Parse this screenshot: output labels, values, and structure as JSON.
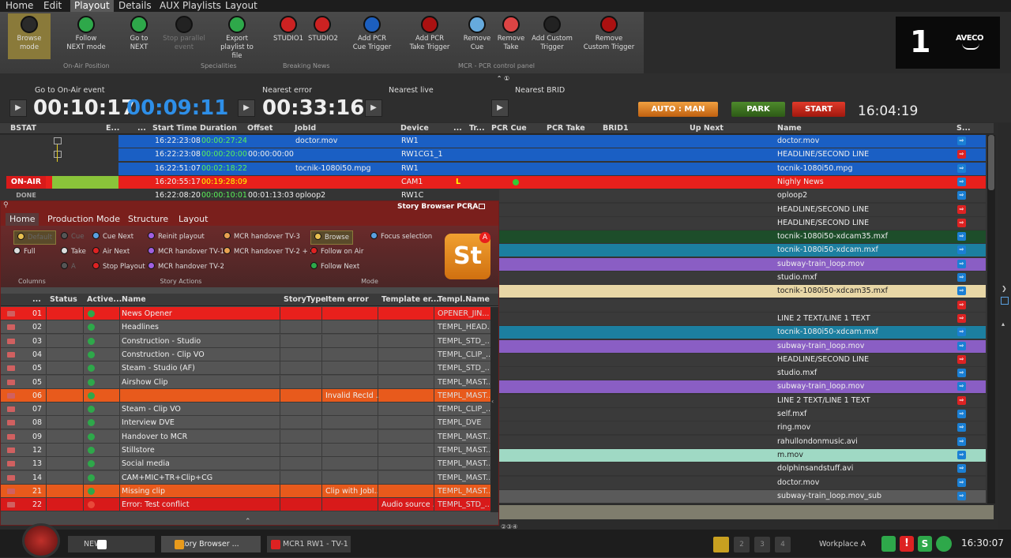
{
  "menu": [
    "Home",
    "Edit",
    "Playout",
    "Details",
    "AUX Playlists",
    "Layout"
  ],
  "menu_active": "Playout",
  "ribbon": {
    "buttons": [
      {
        "l1": "Browse",
        "l2": "mode",
        "icon": "browse-icon",
        "color": "#2a2a2a"
      },
      {
        "l1": "Follow",
        "l2": "NEXT mode",
        "icon": "follow-next-icon",
        "color": "#2ea84a"
      },
      {
        "l1": "Go to",
        "l2": "NEXT",
        "icon": "goto-next-icon",
        "color": "#2ea84a"
      },
      {
        "l1": "Stop parallel",
        "l2": "event",
        "icon": "stop-parallel-icon",
        "color": "#222"
      },
      {
        "l1": "Export",
        "l2": "playlist to file",
        "icon": "export-icon",
        "color": "#2ea84a"
      },
      {
        "l1": "STUDIO1",
        "l2": "",
        "icon": "news-icon",
        "color": "#c22"
      },
      {
        "l1": "STUDIO2",
        "l2": "",
        "icon": "news-icon",
        "color": "#c22"
      },
      {
        "l1": "Add PCR",
        "l2": "Cue Trigger",
        "icon": "add-pcr-cue-icon",
        "color": "#1c5fbf"
      },
      {
        "l1": "Add PCR",
        "l2": "Take Trigger",
        "icon": "add-pcr-take-icon",
        "color": "#a11"
      },
      {
        "l1": "Remove",
        "l2": "Cue",
        "icon": "remove-cue-icon",
        "color": "#6ad"
      },
      {
        "l1": "Remove",
        "l2": "Take",
        "icon": "remove-take-icon",
        "color": "#d44"
      },
      {
        "l1": "Add Custom",
        "l2": "Trigger",
        "icon": "add-custom-trigger-icon",
        "color": "#222"
      },
      {
        "l1": "Remove",
        "l2": "Custom Trigger",
        "icon": "remove-custom-trigger-icon",
        "color": "#a11"
      }
    ],
    "groups": [
      "On-Air Position",
      "Specialities",
      "Breaking News",
      "MCR - PCR control panel"
    ]
  },
  "brand": {
    "channel": "1",
    "logo": "AVECO"
  },
  "timers": {
    "goto_onair_label": "Go to On-Air event",
    "time1": "00:10:17",
    "time2": "00:09:11",
    "nearest_error_label": "Nearest error",
    "time3": "00:33:16",
    "nearest_live_label": "Nearest live",
    "nearest_brid_label": "Nearest BRID",
    "auto_man": "AUTO : MAN",
    "park": "PARK",
    "start": "START",
    "clock": "16:04:19"
  },
  "grid": {
    "columns": [
      "BSTAT",
      "E...",
      "...",
      "Start Time",
      "Duration",
      "Offset",
      "JobId",
      "Device",
      "...",
      "Tr...",
      "PCR Cue",
      "PCR Take",
      "BRID1",
      "Up Next",
      "Name",
      "S..."
    ],
    "rows": [
      {
        "status": "",
        "start": "16:22:23:08",
        "dur": "00:00:27:24",
        "offset": "",
        "job": "doctor.mov",
        "device": "RW1",
        "name": "doctor.mov",
        "bg": "#1a5fc4",
        "full": true,
        "ico": "#1a7fd4"
      },
      {
        "status": "",
        "start": "16:22:23:08",
        "dur": "00:00:20:00",
        "offset": "00:00:00:00",
        "job": "",
        "device": "RW1CG1_1",
        "name": "HEADLINE/SECOND LINE",
        "bg": "#1a5fc4",
        "full": true,
        "ico": "#d22"
      },
      {
        "status": "",
        "start": "16:22:51:07",
        "dur": "00:02:18:22",
        "offset": "",
        "job": "tocnik-1080i50.mpg",
        "device": "RW1",
        "name": "tocnik-1080i50.mpg",
        "bg": "#1a5fc4",
        "full": true,
        "ico": "#1a7fd4"
      },
      {
        "status": "ON-AIR",
        "start": "16:20:55:17",
        "dur": "00:19:28:09",
        "offset": "",
        "job": "",
        "device": "CAM1",
        "tr": "L",
        "name": "Nighly News",
        "bg": "#e8201c",
        "full": true,
        "ico": "#1a7fd4"
      },
      {
        "status": "DONE",
        "start": "16:22:08:20",
        "dur": "00:00:10:01",
        "offset": "00:01:13:03",
        "job": "oploop2",
        "device": "RW1C",
        "name": "oploop2",
        "bg": "#3a3a3a",
        "full": false,
        "ico": "#1a7fd4"
      },
      {
        "name": "HEADLINE/SECOND LINE",
        "bg": "#3a3a3a",
        "ico": "#d22"
      },
      {
        "name": "HEADLINE/SECOND LINE",
        "bg": "#3a3a3a",
        "ico": "#d22"
      },
      {
        "name": "tocnik-1080i50-xdcam35.mxf",
        "bg": "#1d4d2a",
        "ico": "#1a7fd4"
      },
      {
        "name": "tocnik-1080i50-xdcam.mxf",
        "bg": "#1c7fa0",
        "ico": "#1a7fd4"
      },
      {
        "name": "subway-train_loop.mov",
        "bg": "#8a5ec4",
        "ico": "#1a7fd4"
      },
      {
        "name": "studio.mxf",
        "bg": "#3a3a3a",
        "ico": "#1a7fd4"
      },
      {
        "name": "tocnik-1080i50-xdcam35.mxf",
        "bg": "#e8d7a6",
        "ico": "#1a7fd4",
        "dark": true
      },
      {
        "name": "",
        "bg": "#3a3a3a",
        "ico": "#d22"
      },
      {
        "name": "LINE 2 TEXT/LINE 1 TEXT",
        "bg": "#3a3a3a",
        "ico": "#d22"
      },
      {
        "name": "tocnik-1080i50-xdcam.mxf",
        "bg": "#1c7fa0",
        "ico": "#1a7fd4"
      },
      {
        "name": "subway-train_loop.mov",
        "bg": "#8a5ec4",
        "ico": "#1a7fd4"
      },
      {
        "name": "HEADLINE/SECOND LINE",
        "bg": "#3a3a3a",
        "ico": "#d22"
      },
      {
        "name": "studio.mxf",
        "bg": "#3a3a3a",
        "ico": "#1a7fd4"
      },
      {
        "name": "subway-train_loop.mov",
        "bg": "#8a5ec4",
        "ico": "#1a7fd4"
      },
      {
        "name": "LINE 2 TEXT/LINE 1 TEXT",
        "bg": "#3a3a3a",
        "ico": "#d22"
      },
      {
        "name": "self.mxf",
        "bg": "#3a3a3a",
        "ico": "#1a7fd4"
      },
      {
        "name": "ring.mov",
        "bg": "#3a3a3a",
        "ico": "#1a7fd4"
      },
      {
        "name": "rahullondonmusic.avi",
        "bg": "#3a3a3a",
        "ico": "#1a7fd4"
      },
      {
        "name": "m.mov",
        "bg": "#9fd9c4",
        "ico": "#1a7fd4",
        "dark": true
      },
      {
        "name": "dolphinsandstuff.avi",
        "bg": "#3a3a3a",
        "ico": "#1a7fd4"
      },
      {
        "name": "doctor.mov",
        "bg": "#3a3a3a",
        "ico": "#1a7fd4"
      },
      {
        "name": "subway-train_loop.mov_sub",
        "bg": "#5a5a5a",
        "ico": "#1a7fd4"
      }
    ]
  },
  "story_browser": {
    "title": "Story Browser PCRA",
    "tabs": [
      "Home",
      "Production Mode",
      "Structure",
      "Layout"
    ],
    "columns_group": {
      "label": "Columns",
      "items": [
        "Default",
        "Full"
      ]
    },
    "story_actions": {
      "label": "Story Actions",
      "items": [
        "Cue",
        "Cue Next",
        "Reinit playout",
        "MCR handover TV-3",
        "Take",
        "Air Next",
        "MCR handover TV-1",
        "MCR handover TV-2 + 3",
        "A",
        "Stop Playout",
        "MCR handover TV-2"
      ]
    },
    "mode": {
      "label": "Mode",
      "items": [
        "Browse",
        "Focus selection",
        "Follow on Air",
        "Follow Next"
      ]
    },
    "logo": "St",
    "header": [
      "...",
      "Status",
      "Active...",
      "Name",
      "StoryType",
      "Item error",
      "Template er...",
      "Templ.Name"
    ],
    "rows": [
      {
        "num": "01",
        "status": "ON-AIR",
        "active": "#2ea84a",
        "name": "News Opener",
        "err": "",
        "terr": "",
        "tname": "OPENER_JIN...",
        "bg": "#e8201c",
        "badge": "#c41818"
      },
      {
        "num": "02",
        "status": "NEXT",
        "active": "#2ea84a",
        "name": "Headlines",
        "err": "",
        "terr": "",
        "tname": "TEMPL_HEAD...",
        "bg": "#555",
        "badge": "#4a7a1c"
      },
      {
        "num": "03",
        "status": "",
        "active": "#2ea84a",
        "name": "Construction - Studio",
        "err": "",
        "terr": "",
        "tname": "TEMPL_STD_...",
        "bg": "#555"
      },
      {
        "num": "04",
        "status": "",
        "active": "#2ea84a",
        "name": "Construction - Clip VO",
        "err": "",
        "terr": "",
        "tname": "TEMPL_CLIP_...",
        "bg": "#555"
      },
      {
        "num": "05",
        "status": "",
        "active": "#2ea84a",
        "name": "Steam - Studio (AF)",
        "err": "",
        "terr": "",
        "tname": "TEMPL_STD_...",
        "bg": "#555"
      },
      {
        "num": "05",
        "status": "",
        "active": "#2ea84a",
        "name": "Airshow Clip",
        "err": "",
        "terr": "",
        "tname": "TEMPL_MAST...",
        "bg": "#555"
      },
      {
        "num": "06",
        "status": "",
        "active": "#2ea84a",
        "name": "",
        "err": "Invalid RecId ...",
        "terr": "",
        "tname": "TEMPL_MAST...",
        "bg": "#e85a1c"
      },
      {
        "num": "07",
        "status": "",
        "active": "#2ea84a",
        "name": "Steam - Clip VO",
        "err": "",
        "terr": "",
        "tname": "TEMPL_CLIP_...",
        "bg": "#555"
      },
      {
        "num": "08",
        "status": "",
        "active": "#2ea84a",
        "name": "Interview DVE",
        "err": "",
        "terr": "",
        "tname": "TEMPL_DVE",
        "bg": "#555"
      },
      {
        "num": "09",
        "status": "",
        "active": "#2ea84a",
        "name": "Handover to MCR",
        "err": "",
        "terr": "",
        "tname": "TEMPL_MAST...",
        "bg": "#555"
      },
      {
        "num": "12",
        "status": "",
        "active": "#2ea84a",
        "name": "Stillstore",
        "err": "",
        "terr": "",
        "tname": "TEMPL_MAST...",
        "bg": "#555"
      },
      {
        "num": "13",
        "status": "",
        "active": "#2ea84a",
        "name": "Social media",
        "err": "",
        "terr": "",
        "tname": "TEMPL_MAST...",
        "bg": "#555"
      },
      {
        "num": "14",
        "status": "",
        "active": "#2ea84a",
        "name": "CAM+MIC+TR+Clip+CG",
        "err": "",
        "terr": "",
        "tname": "TEMPL_MAST...",
        "bg": "#555"
      },
      {
        "num": "21",
        "status": "",
        "active": "#2ea84a",
        "name": "Missing clip",
        "err": "Clip with JobI...",
        "terr": "",
        "tname": "TEMPL_MAST...",
        "bg": "#e85a1c"
      },
      {
        "num": "22",
        "status": "",
        "active": "#e84a3a",
        "name": "Error: Test conflict",
        "err": "",
        "terr": "Audio source ...",
        "tname": "TEMPL_STD_...",
        "bg": "#d81a1a"
      }
    ]
  },
  "statusbar": {
    "tasks": [
      "NEWS",
      "Story Browser ...",
      "MCR1 RW1 - TV-1"
    ],
    "workplace": "Workplace A",
    "clock": "16:30:07",
    "pages": [
      "1",
      "2",
      "3",
      "4"
    ]
  }
}
